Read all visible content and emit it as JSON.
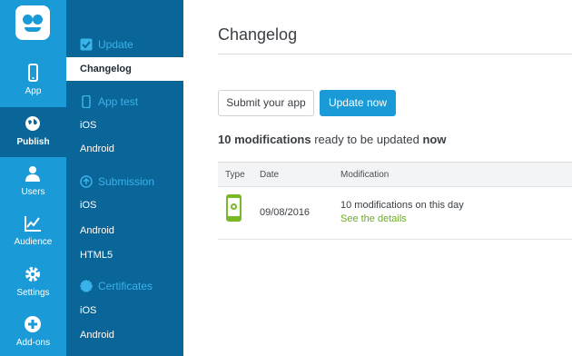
{
  "colors": {
    "rail": "#1a9ad6",
    "rail_active": "#0a6698",
    "sidebar": "#0a6698",
    "accent": "#1a9ad6",
    "success": "#79b928"
  },
  "rail": {
    "items": [
      {
        "label": "App",
        "icon": "phone-icon"
      },
      {
        "label": "Publish",
        "icon": "globe-icon"
      },
      {
        "label": "Users",
        "icon": "user-icon"
      },
      {
        "label": "Audience",
        "icon": "chart-icon"
      },
      {
        "label": "Settings",
        "icon": "gear-icon"
      },
      {
        "label": "Add-ons",
        "icon": "plus-circle-icon"
      }
    ]
  },
  "sidebar": {
    "sections": [
      {
        "title": "Update",
        "icon": "checkbox-icon",
        "items": [
          "Changelog"
        ]
      },
      {
        "title": "App test",
        "icon": "phone-icon",
        "items": [
          "iOS",
          "Android"
        ]
      },
      {
        "title": "Submission",
        "icon": "upload-icon",
        "items": [
          "iOS",
          "Android",
          "HTML5"
        ]
      },
      {
        "title": "Certificates",
        "icon": "badge-icon",
        "items": [
          "iOS",
          "Android"
        ]
      }
    ]
  },
  "main": {
    "title": "Changelog",
    "submit_label": "Submit your app",
    "update_label": "Update now",
    "summary": {
      "count": "10 modifications",
      "middle": " ready to be updated ",
      "now": "now"
    },
    "table": {
      "headers": [
        "Type",
        "Date",
        "Modification"
      ],
      "rows": [
        {
          "date": "09/08/2016",
          "modification": "10 modifications on this day",
          "link": "See the details"
        }
      ]
    }
  }
}
